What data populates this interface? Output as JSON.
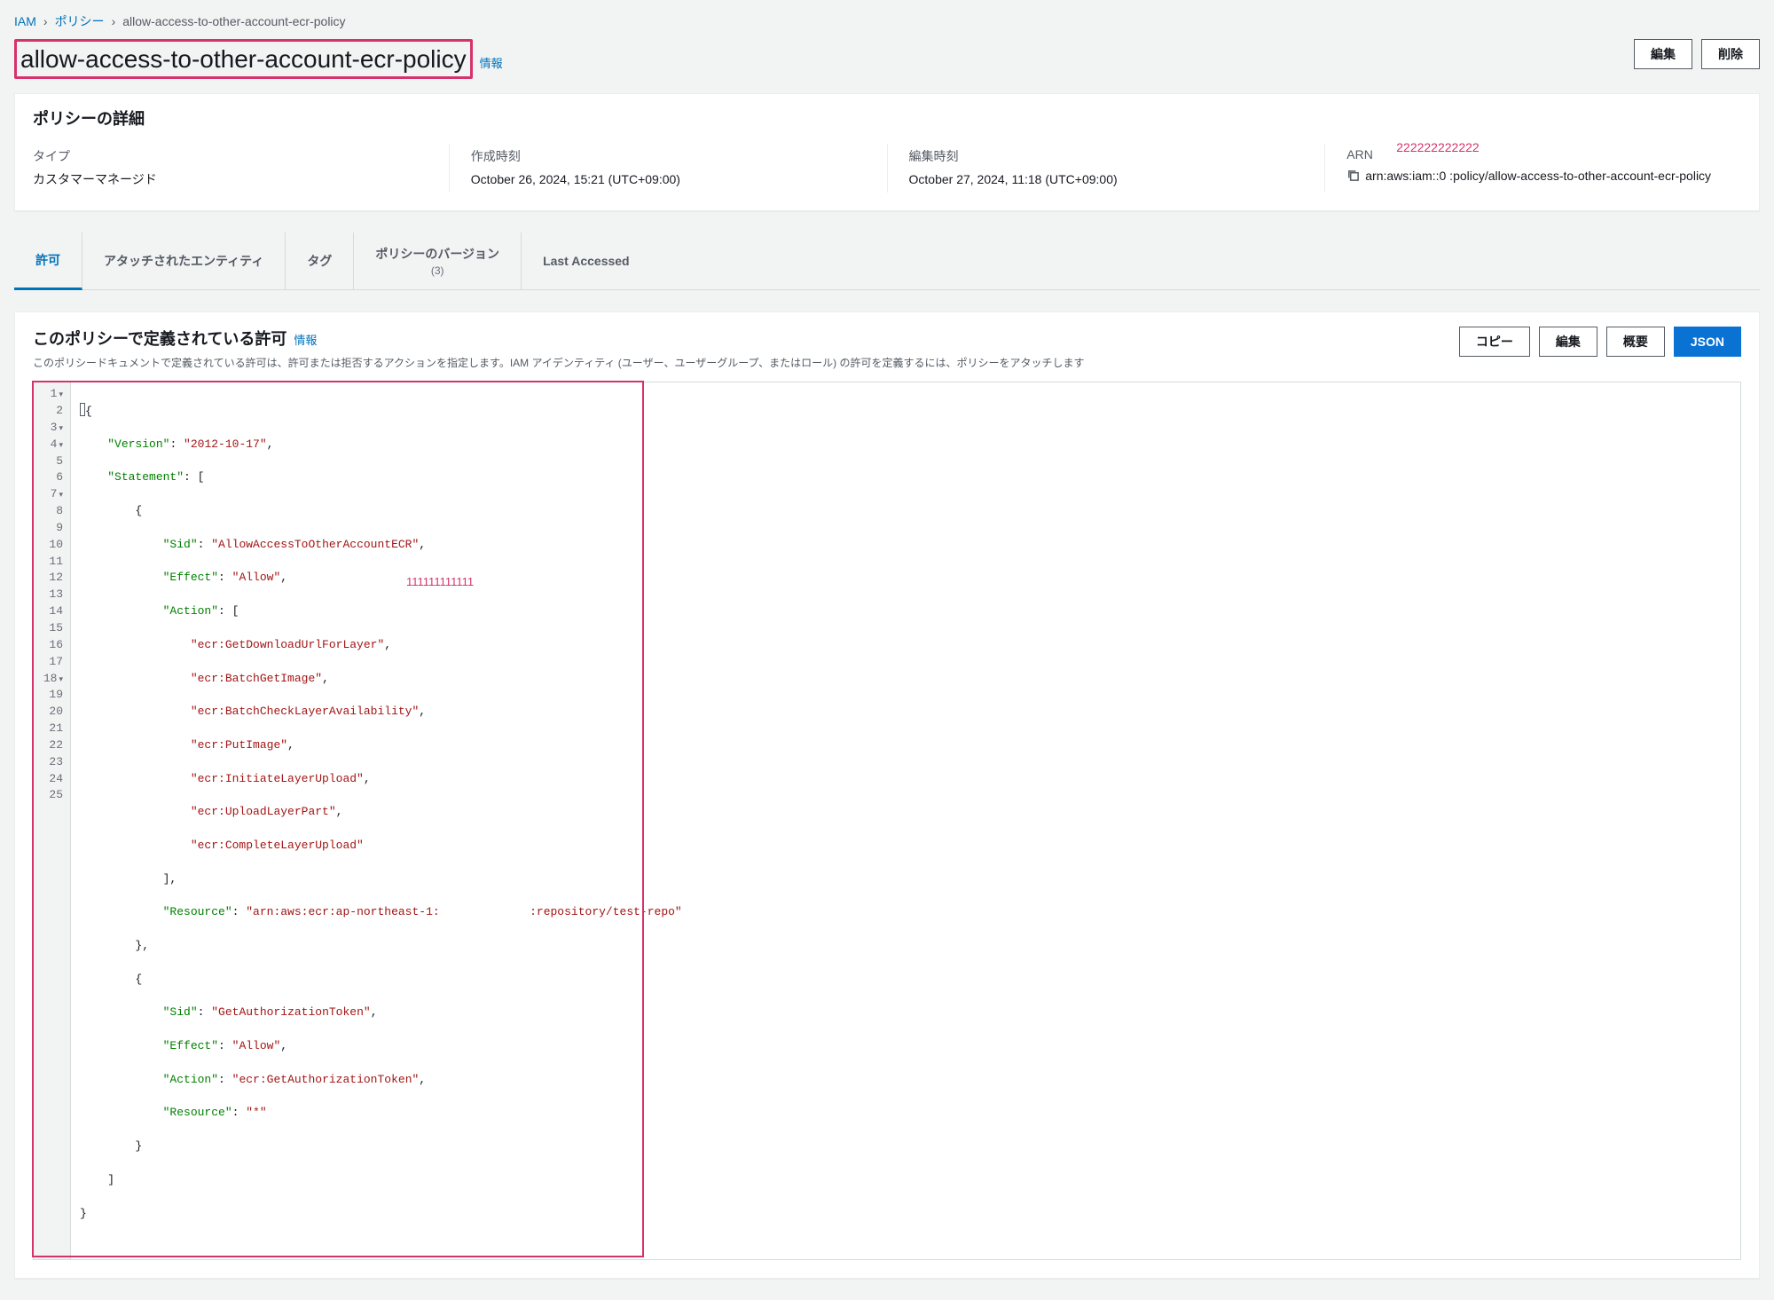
{
  "breadcrumb": {
    "iam": "IAM",
    "policies": "ポリシー",
    "current": "allow-access-to-other-account-ecr-policy"
  },
  "header": {
    "title": "allow-access-to-other-account-ecr-policy",
    "info": "情報",
    "edit": "編集",
    "delete": "削除"
  },
  "details": {
    "panel_title": "ポリシーの詳細",
    "type_label": "タイプ",
    "type_value": "カスタマーマネージド",
    "created_label": "作成時刻",
    "created_value": "October 26, 2024, 15:21 (UTC+09:00)",
    "edited_label": "編集時刻",
    "edited_value": "October 27, 2024, 11:18 (UTC+09:00)",
    "arn_label": "ARN",
    "arn_value": "arn:aws:iam::0                             :policy/allow-access-to-other-account-ecr-policy",
    "arn_annotation": "222222222222"
  },
  "tabs": {
    "permissions": "許可",
    "attached": "アタッチされたエンティティ",
    "tags": "タグ",
    "versions": "ポリシーのバージョン",
    "versions_count": "(3)",
    "last_accessed": "Last Accessed"
  },
  "permissions": {
    "title": "このポリシーで定義されている許可",
    "info": "情報",
    "desc": "このポリシードキュメントで定義されている許可は、許可または拒否するアクションを指定します。IAM アイデンティティ (ユーザー、ユーザーグループ、またはロール) の許可を定義するには、ポリシーをアタッチします",
    "copy": "コピー",
    "edit": "編集",
    "summary": "概要",
    "json": "JSON"
  },
  "json_annotation": "111111111111",
  "code": {
    "l1": "{",
    "l2_k": "\"Version\"",
    "l2_v": "\"2012-10-17\"",
    "l3_k": "\"Statement\"",
    "l5_k": "\"Sid\"",
    "l5_v": "\"AllowAccessToOtherAccountECR\"",
    "l6_k": "\"Effect\"",
    "l6_v": "\"Allow\"",
    "l7_k": "\"Action\"",
    "l8": "\"ecr:GetDownloadUrlForLayer\"",
    "l9": "\"ecr:BatchGetImage\"",
    "l10": "\"ecr:BatchCheckLayerAvailability\"",
    "l11": "\"ecr:PutImage\"",
    "l12": "\"ecr:InitiateLayerUpload\"",
    "l13": "\"ecr:UploadLayerPart\"",
    "l14": "\"ecr:CompleteLayerUpload\"",
    "l16_k": "\"Resource\"",
    "l16_v": "\"arn:aws:ecr:ap-northeast-1:             :repository/test-repo\"",
    "l19_k": "\"Sid\"",
    "l19_v": "\"GetAuthorizationToken\"",
    "l20_k": "\"Effect\"",
    "l20_v": "\"Allow\"",
    "l21_k": "\"Action\"",
    "l21_v": "\"ecr:GetAuthorizationToken\"",
    "l22_k": "\"Resource\"",
    "l22_v": "\"*\""
  }
}
